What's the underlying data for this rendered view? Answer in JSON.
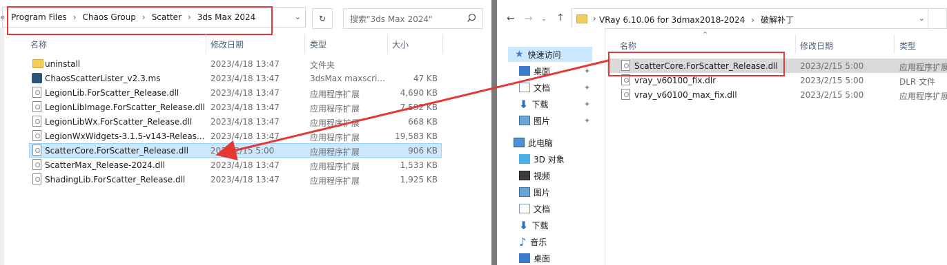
{
  "left": {
    "breadcrumb": [
      "Program Files",
      "Chaos Group",
      "Scatter",
      "3ds Max 2024"
    ],
    "search_placeholder": "搜索\"3ds Max 2024\"",
    "columns": [
      "名称",
      "修改日期",
      "类型",
      "大小"
    ],
    "files": [
      {
        "name": "uninstall",
        "date": "2023/4/18 13:47",
        "type": "文件夹",
        "size": "",
        "icon": "folder-icon"
      },
      {
        "name": "ChaosScatterLister_v2.3.ms",
        "date": "2023/4/18 13:47",
        "type": "3dsMax maxscri...",
        "size": "47 KB",
        "icon": "maxscript-icon"
      },
      {
        "name": "LegionLib.ForScatter_Release.dll",
        "date": "2023/4/18 13:47",
        "type": "应用程序扩展",
        "size": "4,690 KB",
        "icon": "dll-icon"
      },
      {
        "name": "LegionLibImage.ForScatter_Release.dll",
        "date": "2023/4/18 13:47",
        "type": "应用程序扩展",
        "size": "7,592 KB",
        "icon": "dll-icon"
      },
      {
        "name": "LegionLibWx.ForScatter_Release.dll",
        "date": "2023/4/18 13:47",
        "type": "应用程序扩展",
        "size": "668 KB",
        "icon": "dll-icon"
      },
      {
        "name": "LegionWxWidgets-3.1.5-v143-Releas...",
        "date": "2023/4/18 13:47",
        "type": "应用程序扩展",
        "size": "19,583 KB",
        "icon": "dll-icon"
      },
      {
        "name": "ScatterCore.ForScatter_Release.dll",
        "date": "2023/2/15 5:00",
        "type": "应用程序扩展",
        "size": "906 KB",
        "icon": "dll-icon",
        "selected": true
      },
      {
        "name": "ScatterMax_Release-2024.dll",
        "date": "2023/4/18 13:47",
        "type": "应用程序扩展",
        "size": "1,533 KB",
        "icon": "dll-icon"
      },
      {
        "name": "ShadingLib.ForScatter_Release.dll",
        "date": "2023/4/18 13:47",
        "type": "应用程序扩展",
        "size": "1,925 KB",
        "icon": "dll-icon"
      }
    ]
  },
  "right": {
    "breadcrumb": [
      "VRay 6.10.06 for 3dmax2018-2024",
      "破解补丁"
    ],
    "columns": [
      "名称",
      "修改日期",
      "类型"
    ],
    "files": [
      {
        "name": "ScatterCore.ForScatter_Release.dll",
        "date": "2023/2/15 5:00",
        "type": "应用程序扩展",
        "highlighted": true
      },
      {
        "name": "vray_v60100_fix.dlr",
        "date": "2023/2/15 5:00",
        "type": "DLR 文件"
      },
      {
        "name": "vray_v60100_max_fix.dll",
        "date": "2023/2/15 5:00",
        "type": "应用程序扩展"
      }
    ],
    "nav": {
      "quick_access": "快速访问",
      "quick_items": [
        "桌面",
        "文档",
        "下载",
        "图片"
      ],
      "this_pc": "此电脑",
      "pc_items": [
        "3D 对象",
        "视频",
        "图片",
        "文档",
        "下载",
        "音乐",
        "桌面"
      ]
    }
  },
  "colors": {
    "annotation_red": "#e53935",
    "selection_blue": "#cce8ff",
    "folder_yellow": "#f5cd5b"
  }
}
